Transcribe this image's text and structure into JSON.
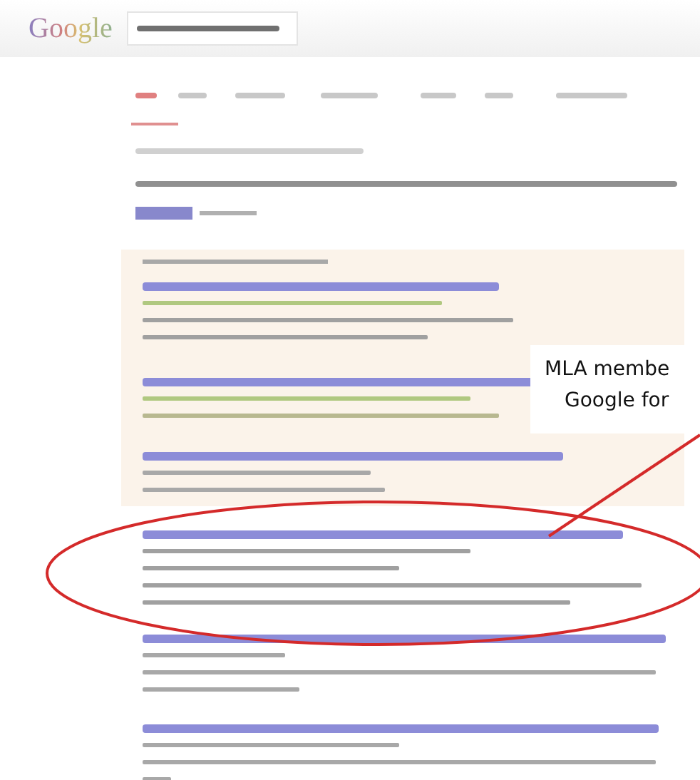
{
  "search_page": {
    "logo": "Google"
  },
  "callout": {
    "lines": [
      "MLA membe",
      "Google for"
    ]
  }
}
